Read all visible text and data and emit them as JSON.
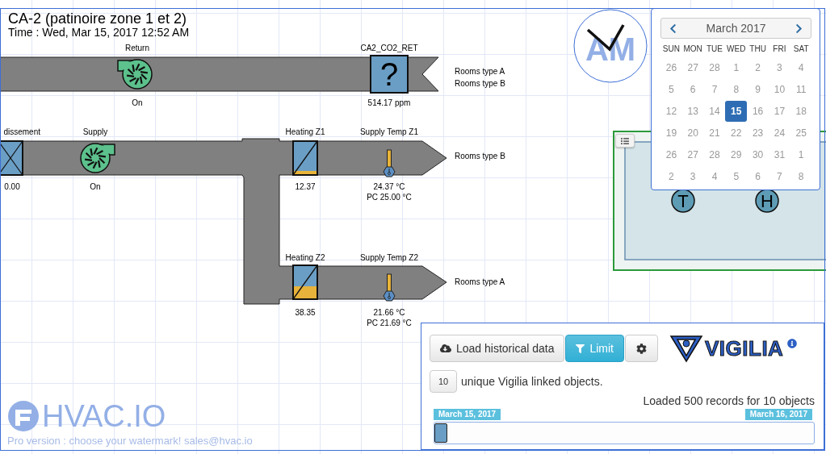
{
  "header": {
    "title": "CA-2 (patinoire zone 1 et 2)",
    "time": "Time : Wed, Mar 15, 2017 12:52 AM"
  },
  "equipment": [
    {
      "kind": "fan",
      "label": "Return",
      "value": "On",
      "on": true
    },
    {
      "kind": "sensor",
      "label": "CA2_CO2_RET",
      "value": "514.17 ppm",
      "symbol": "?"
    },
    {
      "kind": "damper",
      "label": "dissement",
      "value": "0.00"
    },
    {
      "kind": "fan",
      "label": "Supply",
      "value": "On",
      "on": true
    },
    {
      "kind": "coil",
      "label": "Heating Z1",
      "value": "12.37",
      "level": 0.12
    },
    {
      "kind": "thermometer",
      "label": "Supply Temp Z1",
      "value": "24.37 °C",
      "setpoint": "PC 25.00 °C"
    },
    {
      "kind": "coil",
      "label": "Heating Z2",
      "value": "38.35",
      "level": 0.38
    },
    {
      "kind": "thermometer",
      "label": "Supply Temp Z2",
      "value": "21.66 °C",
      "setpoint": "PC 21.69 °C"
    }
  ],
  "outlets": [
    {
      "labels": [
        "Rooms type A",
        "Rooms type B"
      ]
    },
    {
      "labels": [
        "Rooms type B"
      ]
    },
    {
      "labels": [
        "Rooms type A"
      ]
    }
  ],
  "clock": {
    "text": "AM"
  },
  "zone": {
    "sensors": [
      "T",
      "H"
    ]
  },
  "calendar": {
    "month": "March 2017",
    "weekdays": [
      "SUN",
      "MON",
      "TUE",
      "WED",
      "THU",
      "FRI",
      "SAT"
    ],
    "days": [
      {
        "label": "26",
        "selected": false
      },
      {
        "label": "27",
        "selected": false
      },
      {
        "label": "28",
        "selected": false
      },
      {
        "label": "1",
        "selected": false
      },
      {
        "label": "2",
        "selected": false
      },
      {
        "label": "3",
        "selected": false
      },
      {
        "label": "4",
        "selected": false
      },
      {
        "label": "5",
        "selected": false
      },
      {
        "label": "6",
        "selected": false
      },
      {
        "label": "7",
        "selected": false
      },
      {
        "label": "8",
        "selected": false
      },
      {
        "label": "9",
        "selected": false
      },
      {
        "label": "10",
        "selected": false
      },
      {
        "label": "11",
        "selected": false
      },
      {
        "label": "12",
        "selected": false
      },
      {
        "label": "13",
        "selected": false
      },
      {
        "label": "14",
        "selected": false
      },
      {
        "label": "15",
        "selected": true
      },
      {
        "label": "16",
        "selected": false
      },
      {
        "label": "17",
        "selected": false
      },
      {
        "label": "18",
        "selected": false
      },
      {
        "label": "19",
        "selected": false
      },
      {
        "label": "20",
        "selected": false
      },
      {
        "label": "21",
        "selected": false
      },
      {
        "label": "22",
        "selected": false
      },
      {
        "label": "23",
        "selected": false
      },
      {
        "label": "24",
        "selected": false
      },
      {
        "label": "25",
        "selected": false
      },
      {
        "label": "26",
        "selected": false
      },
      {
        "label": "27",
        "selected": false
      },
      {
        "label": "28",
        "selected": false
      },
      {
        "label": "29",
        "selected": false
      },
      {
        "label": "30",
        "selected": false
      },
      {
        "label": "31",
        "selected": false
      },
      {
        "label": "1",
        "selected": false
      },
      {
        "label": "2",
        "selected": false
      },
      {
        "label": "3",
        "selected": false
      },
      {
        "label": "4",
        "selected": false
      },
      {
        "label": "5",
        "selected": false
      },
      {
        "label": "6",
        "selected": false
      },
      {
        "label": "7",
        "selected": false
      },
      {
        "label": "8",
        "selected": false
      }
    ]
  },
  "vigilia": {
    "buttons": [
      {
        "kind": "load",
        "label": "Load historical data",
        "selected": false
      },
      {
        "kind": "limit",
        "label": "Limit",
        "selected": true
      },
      {
        "kind": "settings",
        "selected": false
      }
    ],
    "logo": "VIGILIA",
    "count": "10",
    "count_text": "unique Vigilia linked objects.",
    "status": "Loaded 500 records for 10 objects",
    "range_start": "March 15, 2017",
    "range_end": "March 16, 2017",
    "level": 0
  },
  "watermark": {
    "logo": "HVAC.IO",
    "text": "Pro version : choose your watermark! sales@hvac.io"
  }
}
